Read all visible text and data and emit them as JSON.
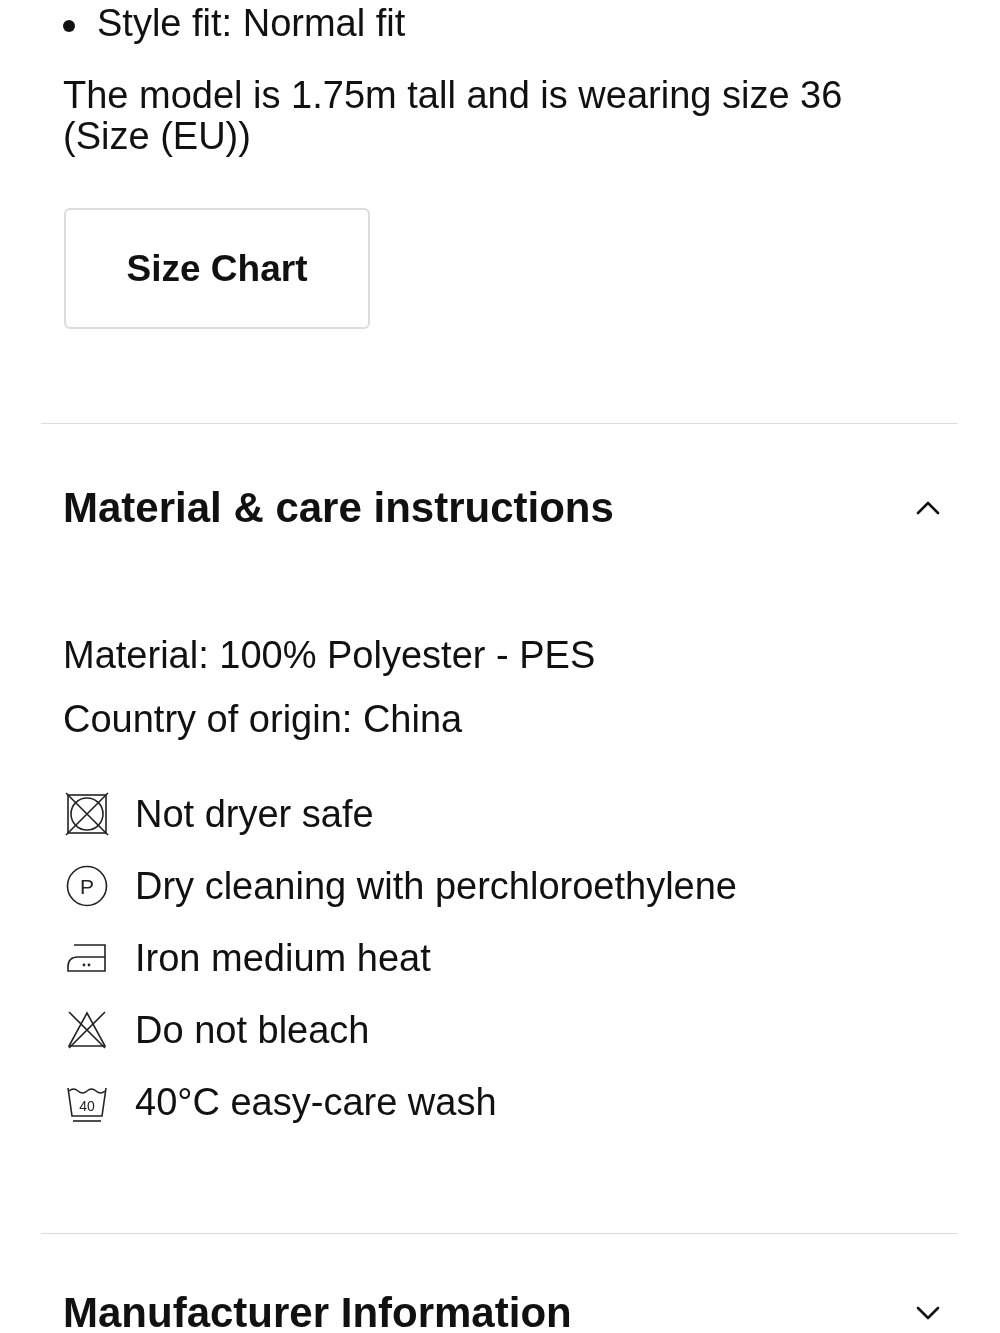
{
  "fit_details": [
    "Style fit: Normal fit"
  ],
  "model_note": "The model is 1.75m tall and is wearing size 36 (Size (EU))",
  "size_chart_button": "Size Chart",
  "sections": [
    {
      "title": "Material & care instructions",
      "expanded": true,
      "details": [
        "Material: 100% Polyester - PES",
        "Country of origin: China"
      ],
      "care": [
        {
          "kind": "no_tumble_dry",
          "label": "Not dryer safe"
        },
        {
          "kind": "dry_clean",
          "symbol": "P",
          "label": "Dry cleaning with perchloroethylene"
        },
        {
          "kind": "iron_medium",
          "label": "Iron medium heat"
        },
        {
          "kind": "no_bleach",
          "label": "Do not bleach"
        },
        {
          "kind": "wash_easy_care",
          "symbol": "40",
          "label": "40°C easy-care wash"
        }
      ]
    },
    {
      "title": "Manufacturer Information",
      "expanded": false
    }
  ]
}
